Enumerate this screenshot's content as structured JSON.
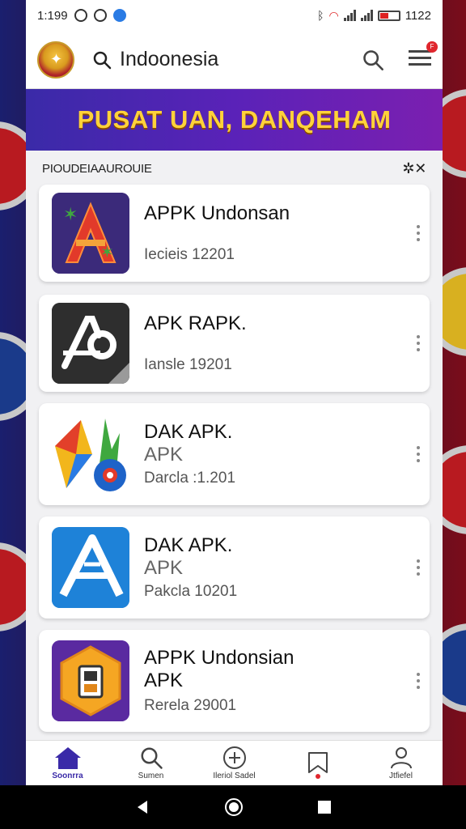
{
  "status_bar": {
    "time": "1:199",
    "battery_text": "1122"
  },
  "top_bar": {
    "search_text": "Indoonesia"
  },
  "notification_badge": "F",
  "banner": {
    "title": "PUSAT UAN, DANQEHAM"
  },
  "section": {
    "title": "PIOUDEIAAUROUIE",
    "close_label": "✲✕"
  },
  "apps": [
    {
      "title": "APPK Undonsan",
      "subtitle": "",
      "meta": "Iecieis 12201",
      "icon": "red-a-cannabis-icon"
    },
    {
      "title": "APK RAPK.",
      "subtitle": "",
      "meta": "Iansle 19201",
      "icon": "ap-logo-icon"
    },
    {
      "title": "DAK APK.",
      "subtitle": "APK",
      "meta": "Darcla :1.201",
      "icon": "colorful-shapes-icon"
    },
    {
      "title": "DAK APK.",
      "subtitle": "APK",
      "meta": "Pakcla 10201",
      "icon": "blue-a-icon"
    },
    {
      "title": "APPK Undonsian",
      "subtitle": "APK",
      "meta": "Rerela 29001",
      "icon": "hexagon-device-icon"
    }
  ],
  "bottom_nav": [
    {
      "label": "Soonrra",
      "icon": "home-icon",
      "active": true
    },
    {
      "label": "Sumen",
      "icon": "search-icon",
      "active": false
    },
    {
      "label": "Ileriol Sadel",
      "icon": "add-circle-icon",
      "active": false
    },
    {
      "label": "",
      "icon": "bookmark-icon",
      "active": false
    },
    {
      "label": "Jtfiefel",
      "icon": "profile-icon",
      "active": false
    }
  ],
  "colors": {
    "banner_text": "#ffd23a",
    "banner_bg": "#5a22b8",
    "accent": "#3a2aa8",
    "badge": "#e0262d"
  }
}
